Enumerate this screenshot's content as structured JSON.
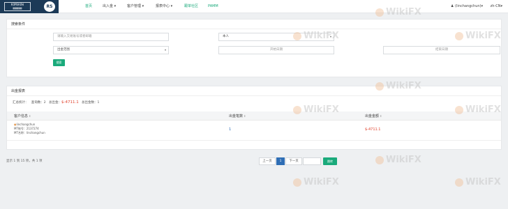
{
  "header": {
    "logo_text": "KOMSKOW",
    "logo_rs": "RS",
    "nav": [
      {
        "label": "首页"
      },
      {
        "label": "出入金"
      },
      {
        "label": "客户管理"
      },
      {
        "label": "报表中心"
      },
      {
        "label": "跟单社区"
      },
      {
        "label": "PAMM"
      }
    ],
    "user": "(linchangchun)",
    "lang": "zh-CN"
  },
  "search": {
    "title": "搜索条件",
    "account_placeholder": "请输入交易账号或者邮箱",
    "scope_value": "本人",
    "date_range_placeholder": "出金范围",
    "start_date_placeholder": "开始日期",
    "end_date_placeholder": "结束日期",
    "search_button": "搜索"
  },
  "report": {
    "title": "出金报表",
    "stats_label": "汇总统计：",
    "count_label": "查询数：",
    "count_value": "2",
    "total_label": "总出金：",
    "total_value": "$-4711.1",
    "total_count_label": "总出金数：",
    "total_count_value": "1",
    "columns": [
      "客户信息",
      "出金笔数",
      "出金金额"
    ],
    "rows": [
      {
        "name": "linchangchun",
        "mt_account_label": "MT账号：",
        "mt_account": "2137274",
        "mt_name_label": "MT名称：",
        "mt_name": "linchangchun",
        "count": "1",
        "amount": "$-4711.1"
      }
    ]
  },
  "pagination": {
    "summary": "显示 1 到 15 项，共 1 项",
    "prev": "上一页",
    "current": "1",
    "next": "下一页",
    "jump": "跳转"
  },
  "watermark": "WikiFX",
  "colors": {
    "accent": "#1aaa7b",
    "header_dark": "#1c3a57",
    "negative": "#e0402b",
    "page_active": "#2f6eb5"
  }
}
